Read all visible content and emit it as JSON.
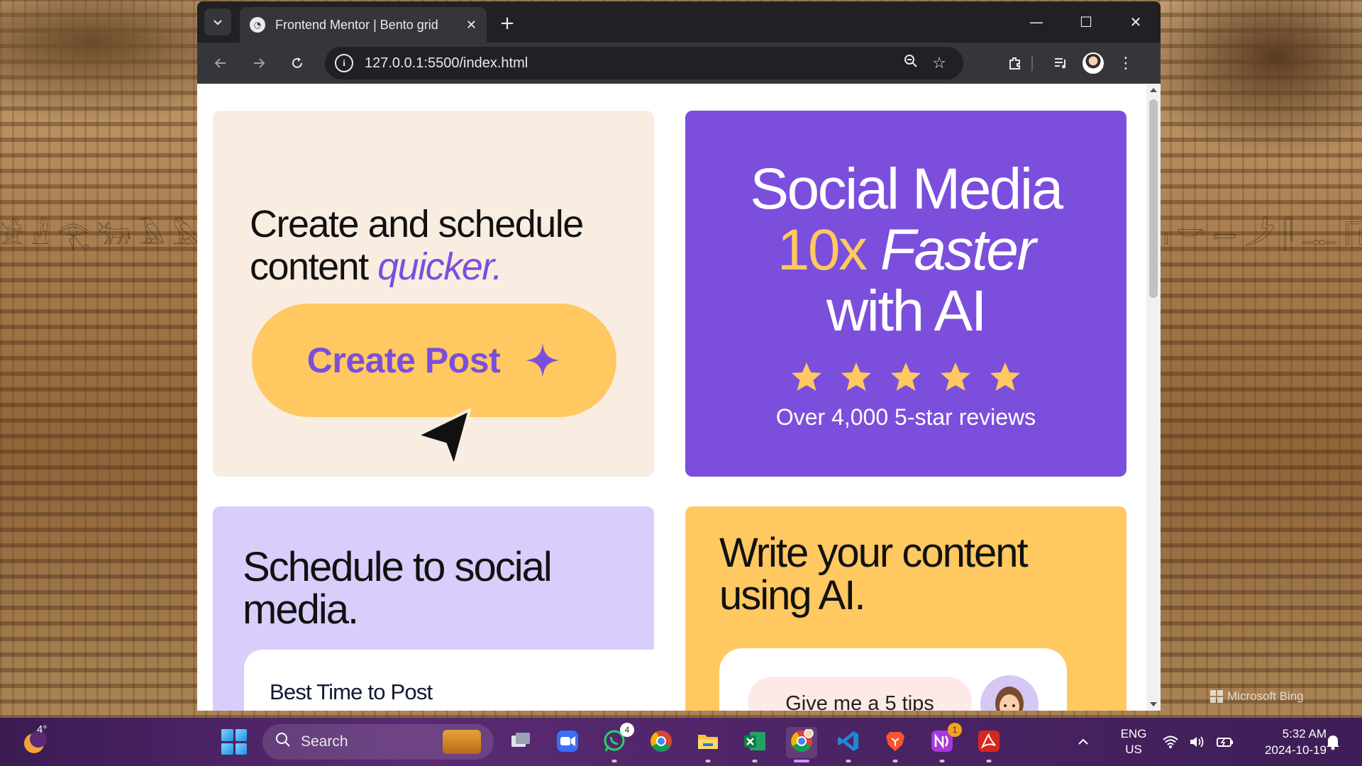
{
  "desktop": {
    "wallpaper_brand": "Microsoft Bing",
    "glyphs_left": "𓀀𓁐𓂀𓃒𓄿𓅓𓆣𓇯𓈖𓉐𓊪𓋹𓌂𓍯𓎛𓏏𓀭𓁹𓂋𓃀𓄂𓅱𓆓𓇋𓈎𓉔𓊃𓋴𓌳𓍿𓎡𓏤",
    "glyphs_right": "𓏤𓎡𓍿𓌳𓋴𓊃𓉔𓈎𓇋𓆓𓅱𓄂𓃀𓂋𓁹𓀭𓏏𓎛𓍯𓌂𓋹𓊪𓉐𓈖𓇯𓆣𓅓𓄿𓃒𓂀𓁐𓀀"
  },
  "browser": {
    "tab": {
      "title": "Frontend Mentor | Bento grid",
      "favicon": "frontend-mentor-icon"
    },
    "address": {
      "url": "127.0.0.1:5500/index.html"
    },
    "window_controls": {
      "minimize": "—",
      "maximize": "☐",
      "close": "✕"
    }
  },
  "page": {
    "create_card": {
      "heading_line1": "Create and schedule",
      "heading_prefix": "content ",
      "heading_emphasis": "quicker.",
      "button_label": "Create Post"
    },
    "social_card": {
      "title_line1": "Social Media",
      "title_accent": "10x",
      "title_italic": "Faster",
      "title_line3": "with AI",
      "rating": 5,
      "reviews_text": "Over 4,000 5-star reviews"
    },
    "schedule_card": {
      "heading": "Schedule to social media.",
      "sub_card_label": "Best Time to Post"
    },
    "write_card": {
      "heading": "Write your content using AI.",
      "chat_prompt": "Give me a 5 tips"
    },
    "colors": {
      "purple": "#7b4fdc",
      "yellow": "#ffc860",
      "cream": "#f9ede2",
      "lavender": "#d9cdfb"
    }
  },
  "taskbar": {
    "weather_temp": "4°",
    "search_label": "Search",
    "apps": [
      {
        "name": "task-view",
        "badge": ""
      },
      {
        "name": "zoom",
        "badge": ""
      },
      {
        "name": "whatsapp",
        "badge": "4"
      },
      {
        "name": "chrome",
        "badge": ""
      },
      {
        "name": "file-explorer",
        "badge": ""
      },
      {
        "name": "excel",
        "badge": ""
      },
      {
        "name": "chrome-profile",
        "badge": ""
      },
      {
        "name": "vscode",
        "badge": ""
      },
      {
        "name": "brave",
        "badge": ""
      },
      {
        "name": "notion-ai",
        "badge": "1"
      },
      {
        "name": "acrobat",
        "badge": ""
      }
    ],
    "lang_line1": "ENG",
    "lang_line2": "US",
    "time": "5:32 AM",
    "date": "2024-10-19"
  }
}
